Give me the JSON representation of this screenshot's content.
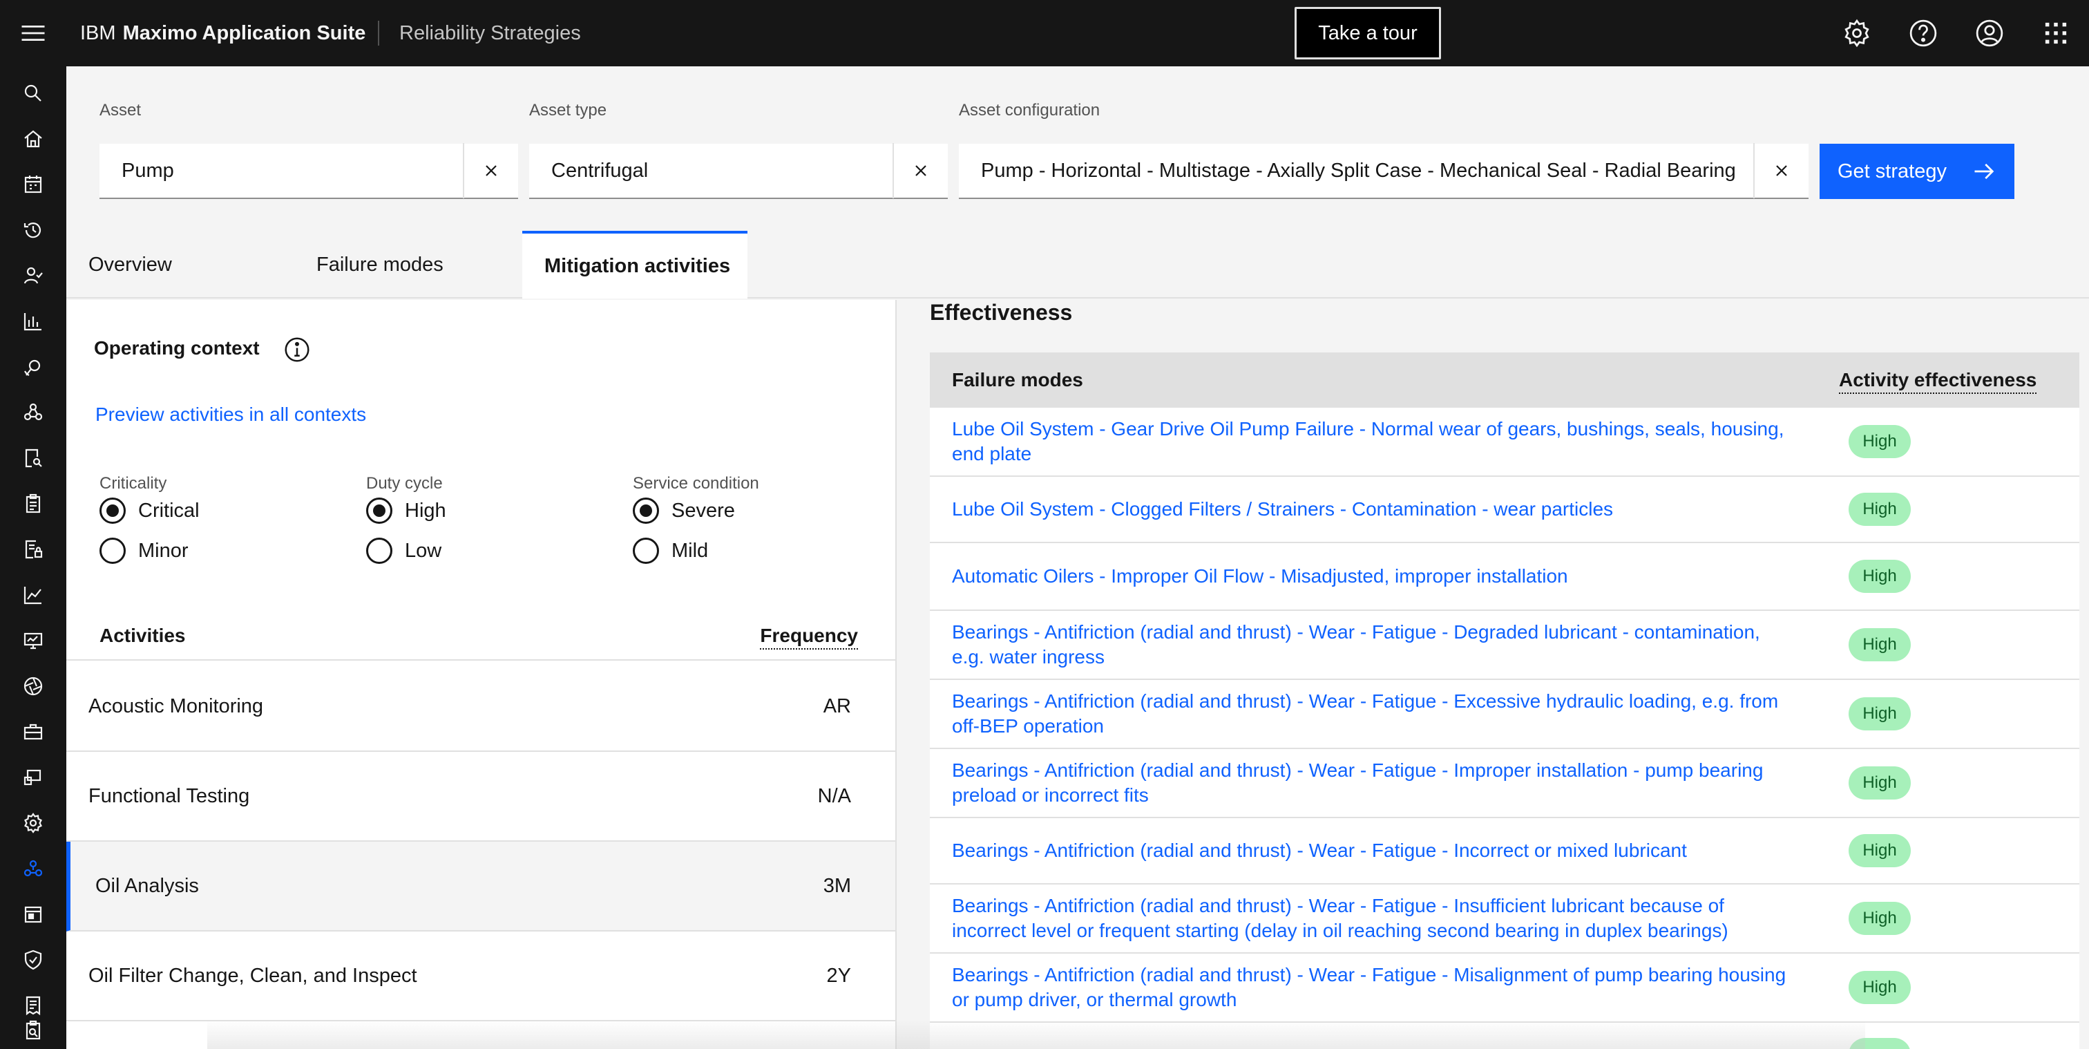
{
  "header": {
    "brand_prefix": "IBM",
    "brand_name": "Maximo Application Suite",
    "app_name": "Reliability Strategies",
    "tour_label": "Take a tour"
  },
  "filters": {
    "asset": {
      "label": "Asset",
      "value": "Pump"
    },
    "asset_type": {
      "label": "Asset type",
      "value": "Centrifugal"
    },
    "asset_config": {
      "label": "Asset configuration",
      "value": "Pump - Horizontal - Multistage - Axially Split Case - Mechanical Seal - Radial Bearing"
    },
    "get_strategy_label": "Get strategy"
  },
  "tabs": [
    {
      "label": "Overview"
    },
    {
      "label": "Failure modes"
    },
    {
      "label": "Mitigation activities"
    }
  ],
  "operating_context": {
    "title": "Operating context",
    "preview_link": "Preview activities in all contexts",
    "criticality": {
      "label": "Criticality",
      "options": [
        "Critical",
        "Minor"
      ],
      "selected": "Critical"
    },
    "duty_cycle": {
      "label": "Duty cycle",
      "options": [
        "High",
        "Low"
      ],
      "selected": "High"
    },
    "service_condition": {
      "label": "Service condition",
      "options": [
        "Severe",
        "Mild"
      ],
      "selected": "Severe"
    }
  },
  "activities": {
    "col_activity": "Activities",
    "col_frequency": "Frequency",
    "rows": [
      {
        "name": "Acoustic Monitoring",
        "frequency": "AR"
      },
      {
        "name": "Functional Testing",
        "frequency": "N/A"
      },
      {
        "name": "Oil Analysis",
        "frequency": "3M"
      },
      {
        "name": "Oil Filter Change, Clean, and Inspect",
        "frequency": "2Y"
      }
    ]
  },
  "effectiveness": {
    "title": "Effectiveness",
    "col_failure_modes": "Failure modes",
    "col_effectiveness": "Activity effectiveness",
    "rows": [
      {
        "failure_mode": "Lube Oil System - Gear Drive Oil Pump Failure - Normal wear of gears, bushings, seals, housing, end plate",
        "effectiveness": "High"
      },
      {
        "failure_mode": "Lube Oil System - Clogged Filters / Strainers - Contamination - wear particles",
        "effectiveness": "High"
      },
      {
        "failure_mode": "Automatic Oilers - Improper Oil Flow - Misadjusted, improper installation",
        "effectiveness": "High"
      },
      {
        "failure_mode": "Bearings - Antifriction (radial and thrust) - Wear - Fatigue - Degraded lubricant - contamination, e.g. water ingress",
        "effectiveness": "High"
      },
      {
        "failure_mode": "Bearings - Antifriction (radial and thrust) - Wear - Fatigue - Excessive hydraulic loading, e.g. from off-BEP operation",
        "effectiveness": "High"
      },
      {
        "failure_mode": "Bearings - Antifriction (radial and thrust) - Wear - Fatigue - Improper installation - pump bearing preload or incorrect fits",
        "effectiveness": "High"
      },
      {
        "failure_mode": "Bearings - Antifriction (radial and thrust) - Wear - Fatigue - Incorrect or mixed lubricant",
        "effectiveness": "High"
      },
      {
        "failure_mode": "Bearings - Antifriction (radial and thrust) - Wear - Fatigue - Insufficient lubricant because of incorrect level or frequent starting (delay in oil reaching second bearing in duplex bearings)",
        "effectiveness": "High"
      },
      {
        "failure_mode": "Bearings - Antifriction (radial and thrust) - Wear - Fatigue - Misalignment of pump bearing housing or pump driver, or thermal growth",
        "effectiveness": "High"
      }
    ]
  },
  "colors": {
    "accent": "#0f62fe",
    "header_bg": "#161616",
    "tag_bg": "#a7f0ba",
    "tag_text": "#0e6027"
  },
  "icons": {
    "menu": "hamburger-menu-icon",
    "settings": "gear-icon",
    "help": "help-icon",
    "user": "user-avatar-icon",
    "switcher": "app-switcher-icon"
  }
}
